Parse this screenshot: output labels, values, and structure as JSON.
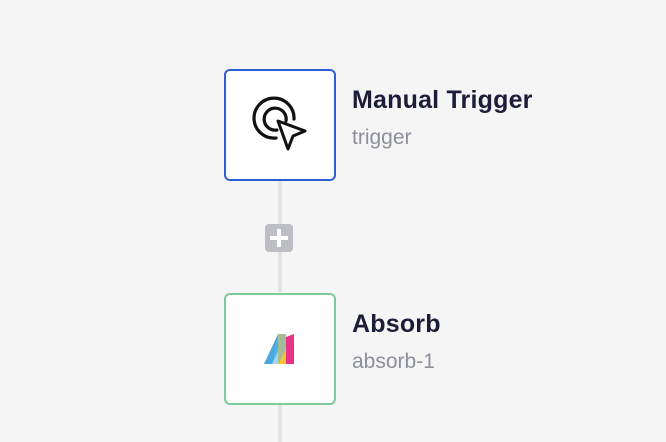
{
  "workflow": {
    "steps": [
      {
        "title": "Manual Trigger",
        "subtitle": "trigger",
        "icon": "cursor-click-icon",
        "border_color": "#2f5dd6"
      },
      {
        "title": "Absorb",
        "subtitle": "absorb-1",
        "icon": "absorb-logo-icon",
        "border_color": "#7ccb98"
      }
    ],
    "add_step_icon": "plus-icon"
  }
}
